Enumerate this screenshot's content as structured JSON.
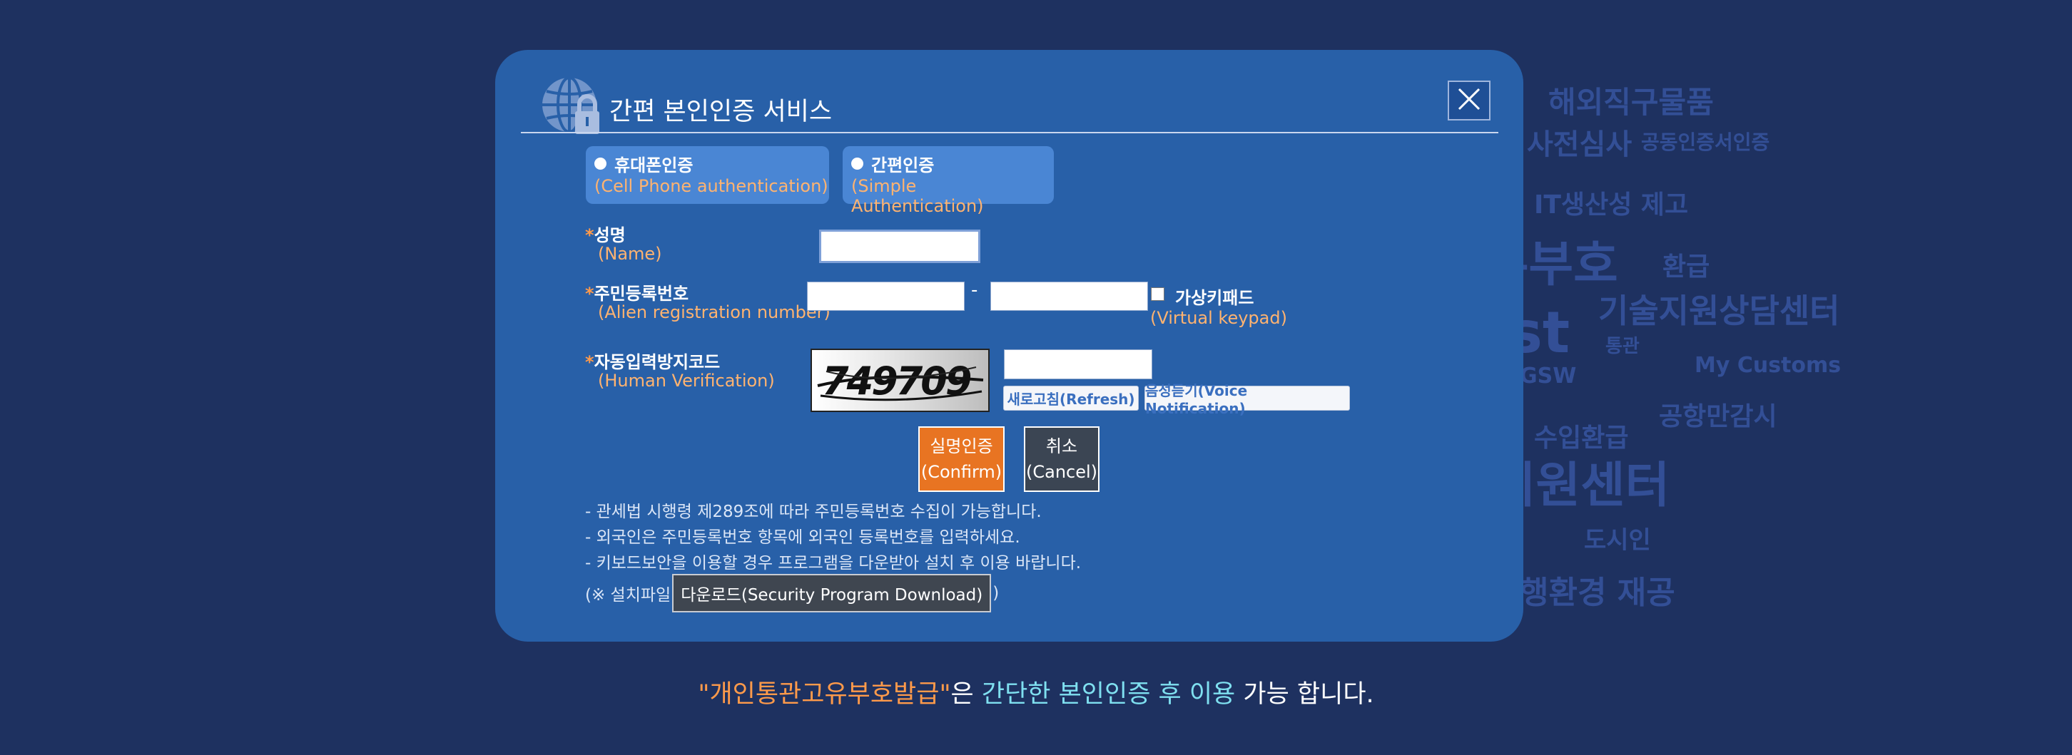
{
  "background_words": [
    "해외직구물품",
    "사전심사",
    "공동인증서인증",
    "IT생산성 제고",
    "유부호",
    "환급",
    "기술지원상담센터",
    "est",
    "통관",
    "GSW",
    "My Customs",
    "수입환급",
    "공항만감시",
    "지원센터",
    "도시인",
    "행환경 재공"
  ],
  "modal": {
    "title": "간편 본인인증 서비스",
    "close_label": "X"
  },
  "auth_tabs": [
    {
      "ko": "휴대폰인증",
      "en": "(Cell Phone authentication)"
    },
    {
      "ko": "간편인증",
      "en": "(Simple Authentication)"
    }
  ],
  "form": {
    "name": {
      "required": "*",
      "ko": "성명",
      "en": "(Name)"
    },
    "registration": {
      "required": "*",
      "ko": "주민등록번호",
      "en": "(Alien registration number)",
      "separator": "-"
    },
    "virtual_keypad": {
      "ko": "가상키패드",
      "en": "(Virtual keypad)"
    },
    "captcha": {
      "required": "*",
      "ko": "자동입력방지코드",
      "en": "(Human Verification)",
      "code": "749709"
    }
  },
  "buttons": {
    "refresh": "새로고침(Refresh)",
    "voice": "음성듣기(Voice Notification)",
    "confirm_ko": "실명인증",
    "confirm_en": "(Confirm)",
    "cancel_ko": "취소",
    "cancel_en": "(Cancel)"
  },
  "notes": [
    "- 관세법 시행령 제289조에 따라 주민등록번호 수집이 가능합니다.",
    "- 외국인은 주민등록번호 항목에 외국인 등록번호를 입력하세요.",
    "- 키보드보안을 이용할 경우 프로그램을 다운받아 설치 후 이용 바랍니다."
  ],
  "install": {
    "prefix": "(※ 설치파일",
    "download": "다운로드(Security Program Download)",
    "suffix": ")"
  },
  "bottom": {
    "part1": "\"개인통관고유부호발급\"",
    "part2": "은 ",
    "part3": "간단한 본인인증 후 이용",
    "part4": " 가능 합니다."
  },
  "colors": {
    "background": "#1e3160",
    "modal": "#2860a8",
    "tab": "#4a86d4",
    "accent_orange": "#ffb370",
    "confirm": "#e87422",
    "cancel": "#3b4553",
    "bottom_orange": "#ff9a4a",
    "bottom_cyan": "#7fe0f0"
  },
  "icons": {
    "globe_lock": "globe-lock-icon",
    "close": "close-icon"
  }
}
